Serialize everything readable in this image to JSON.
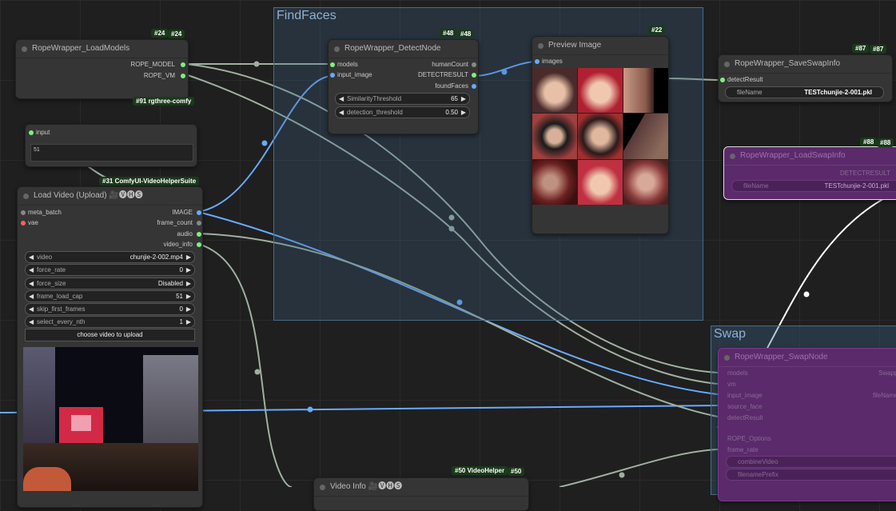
{
  "groups": {
    "findfaces": {
      "title": "FindFaces"
    },
    "swap": {
      "title": "Swap"
    }
  },
  "load_models": {
    "title": "RopeWrapper_LoadModels",
    "badge_a": "#24",
    "badge_b": "#24",
    "outputs": [
      "ROPE_MODEL",
      "ROPE_VM"
    ]
  },
  "rgthree_badge": "#91 rgthree-comfy",
  "input_node": {
    "input_label": "input",
    "value": "51"
  },
  "vhs_badge": "#31 ComfyUI-VideoHelperSuite",
  "load_video": {
    "title": "Load Video (Upload) 🎥🅥🅗🅢",
    "inputs": [
      "meta_batch",
      "vae"
    ],
    "outputs": [
      "IMAGE",
      "frame_count",
      "audio",
      "video_info"
    ],
    "widgets": [
      {
        "label": "video",
        "value": "chunjie-2-002.mp4"
      },
      {
        "label": "force_rate",
        "value": "0"
      },
      {
        "label": "force_size",
        "value": "Disabled"
      },
      {
        "label": "frame_load_cap",
        "value": "51"
      },
      {
        "label": "skip_first_frames",
        "value": "0"
      },
      {
        "label": "select_every_nth",
        "value": "1"
      }
    ],
    "upload_button": "choose video to upload"
  },
  "detect": {
    "title": "RopeWrapper_DetectNode",
    "badge_a": "#48",
    "badge_b": "#48",
    "inputs": [
      "models",
      "input_image"
    ],
    "outputs": [
      "humanCount",
      "DETECTRESULT",
      "foundFaces"
    ],
    "widgets": [
      {
        "label": "SimilarityThreshold",
        "value": "65"
      },
      {
        "label": "detection_threshold",
        "value": "0.50"
      }
    ]
  },
  "preview": {
    "title": "Preview Image",
    "badge": "#22",
    "input": "images"
  },
  "save_swap": {
    "title": "RopeWrapper_SaveSwapInfo",
    "badge_a": "#87",
    "badge_b": "#87",
    "input": "detectResult",
    "widget": {
      "label": "fileName",
      "value": "TESTchunjie-2-001.pkl"
    }
  },
  "load_swap": {
    "title": "RopeWrapper_LoadSwapInfo",
    "badge_a": "#88",
    "badge_b": "#88",
    "output": "DETECTRESULT",
    "widget": {
      "label": "fileName",
      "value": "TESTchunjie-2-001.pkl"
    }
  },
  "swap_node": {
    "title": "RopeWrapper_SwapNode",
    "inputs": [
      "models",
      "vm",
      "input_image",
      "source_face",
      "detectResult",
      "",
      "ROPE_Options",
      "frame_rate"
    ],
    "outputs": [
      "Swapp",
      "fileName"
    ],
    "widgets": [
      "combineVideo",
      "filenamePrefix"
    ]
  },
  "video_info": {
    "title": "Video Info 🎥🅥🅗🅢",
    "badge_a": "#50 VideoHelper",
    "badge_b": "#50"
  },
  "colors": {
    "image_link": "#68aaff",
    "generic_link": "#9fb09f",
    "group_border": "#4a6b88",
    "swap_purple": "#5a2a6a"
  }
}
